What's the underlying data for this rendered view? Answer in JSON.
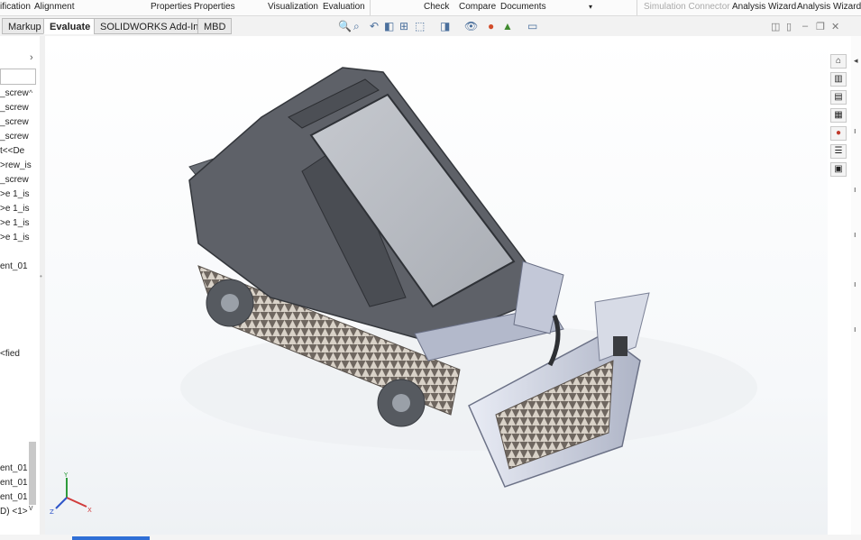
{
  "ribbon": {
    "items": [
      "ification",
      "Alignment",
      "Properties",
      "Properties",
      "Visualization",
      "Evaluation",
      "Check",
      "Compare",
      "Documents",
      "Simulation Connector",
      "Analysis Wizard",
      "Analysis Wizard"
    ]
  },
  "tabs": [
    "Markup",
    "Evaluate",
    "SOLIDWORKS Add-Ins",
    "MBD"
  ],
  "active_tab": "Evaluate",
  "tree": {
    "items": [
      "screw_",
      "screw_",
      "screw_",
      "screw_",
      "t<<De",
      "rew_is<",
      "screw_",
      "e 1_is<",
      "e 1_is<",
      "e 1_is<",
      "e 1_is<",
      "ent_01",
      "fied>",
      "ent_01",
      "ent_01",
      "ent_01",
      "<1> (D"
    ]
  },
  "hud_icons": [
    "zoom-to-fit-icon",
    "zoom-area-icon",
    "previous-view-icon",
    "section-view-icon",
    "dynamic-annotation-icon",
    "view-orientation-icon",
    "display-style-icon",
    "hide-show-icon",
    "edit-appearance-icon",
    "apply-scene-icon",
    "view-settings-icon"
  ],
  "taskpane_icons": [
    "home-icon",
    "resources-icon",
    "design-library-icon",
    "file-explorer-icon",
    "appearances-icon",
    "custom-properties-icon",
    "forum-icon"
  ],
  "triad": {
    "x": "X",
    "y": "Y",
    "z": "Z"
  },
  "colors": {
    "accent": "#2f6fd6",
    "model_body": "#5c5f66",
    "model_glass": "#b9bcc2",
    "tracks": "#9b928a"
  }
}
